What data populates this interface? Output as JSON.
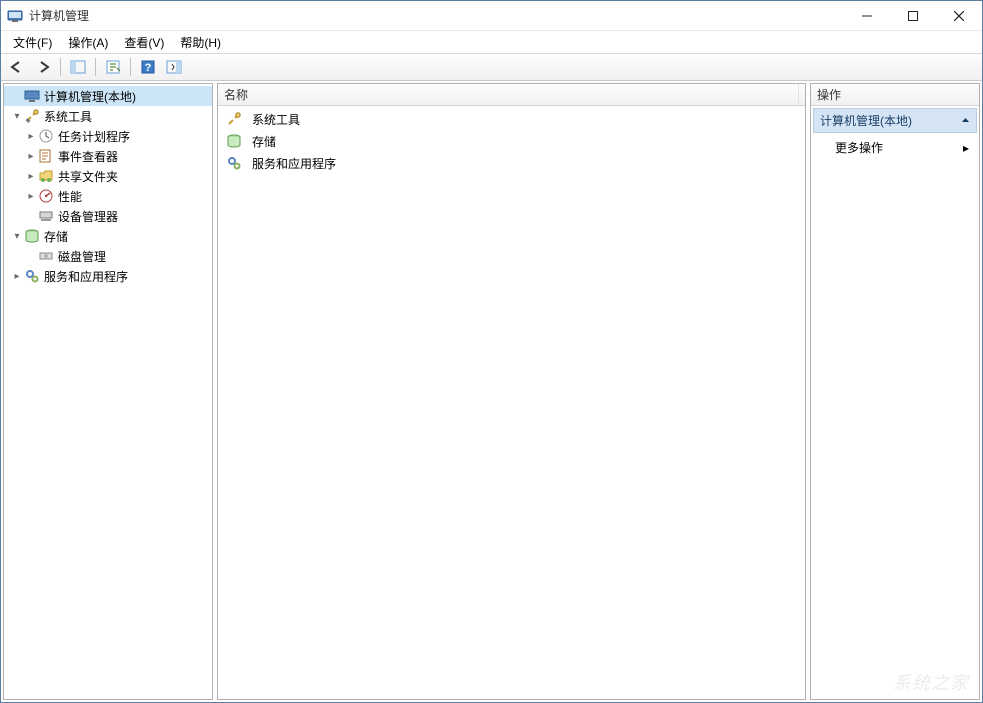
{
  "window": {
    "title": "计算机管理"
  },
  "menus": {
    "file": "文件(F)",
    "action": "操作(A)",
    "view": "查看(V)",
    "help": "帮助(H)"
  },
  "tree": {
    "root": {
      "label": "计算机管理(本地)"
    },
    "system_tools": {
      "label": "系统工具"
    },
    "task_scheduler": {
      "label": "任务计划程序"
    },
    "event_viewer": {
      "label": "事件查看器"
    },
    "shared_folders": {
      "label": "共享文件夹"
    },
    "performance": {
      "label": "性能"
    },
    "device_manager": {
      "label": "设备管理器"
    },
    "storage": {
      "label": "存储"
    },
    "disk_management": {
      "label": "磁盘管理"
    },
    "services_apps": {
      "label": "服务和应用程序"
    }
  },
  "middle": {
    "header_name": "名称",
    "items": {
      "system_tools": "系统工具",
      "storage": "存储",
      "services_apps": "服务和应用程序"
    }
  },
  "actions": {
    "header": "操作",
    "section_title": "计算机管理(本地)",
    "more_actions": "更多操作"
  },
  "watermark": "系统之家"
}
